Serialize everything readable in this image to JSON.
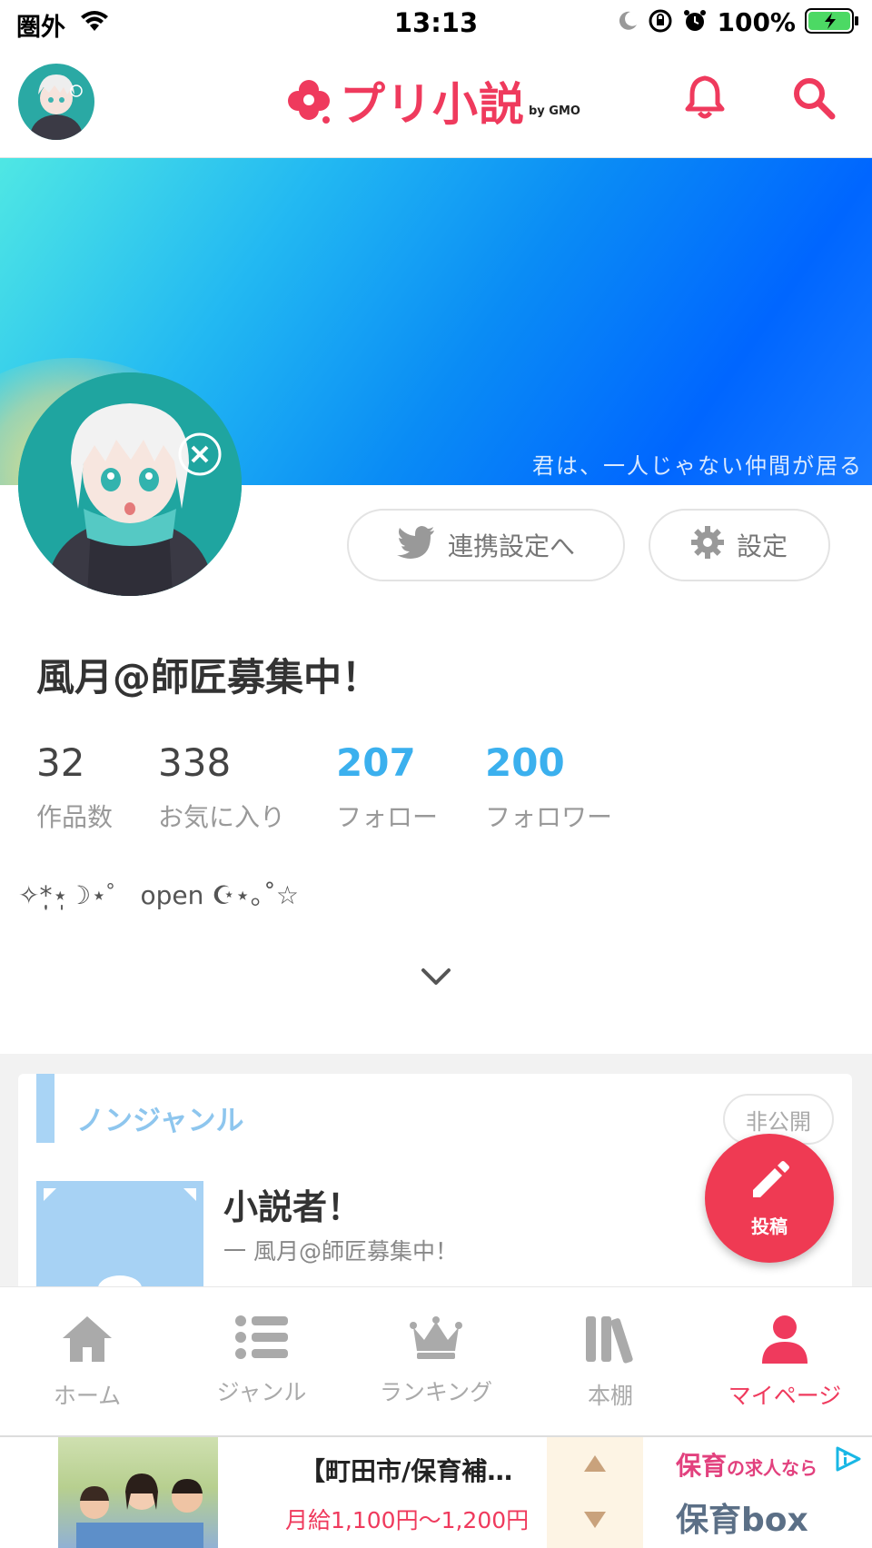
{
  "status_bar": {
    "carrier": "圏外",
    "time": "13:13",
    "battery": "100%"
  },
  "header": {
    "logo_text": "プリ小説",
    "logo_sub": "by GMO"
  },
  "cover": {
    "caption": "君は、一人じゃない仲間が居る"
  },
  "buttons": {
    "link_settings": "連携設定へ",
    "settings": "設定"
  },
  "profile": {
    "name": "風月@師匠募集中！",
    "bio": "✧*̣̩⋆̩☽⋆゜ open ☪⋆｡˚☆"
  },
  "stats": [
    {
      "value": "32",
      "label": "作品数"
    },
    {
      "value": "338",
      "label": "お気に入り"
    },
    {
      "value": "207",
      "label": "フォロー"
    },
    {
      "value": "200",
      "label": "フォロワー"
    }
  ],
  "work": {
    "genre": "ノンジャンル",
    "visibility": "非公開",
    "title": "小説者！",
    "author": "一 風月@師匠募集中！"
  },
  "fab": {
    "label": "投稿"
  },
  "nav": [
    {
      "label": "ホーム",
      "icon": "home-icon",
      "active": false
    },
    {
      "label": "ジャンル",
      "icon": "list-icon",
      "active": false
    },
    {
      "label": "ランキング",
      "icon": "crown-icon",
      "active": false
    },
    {
      "label": "本棚",
      "icon": "bookshelf-icon",
      "active": false
    },
    {
      "label": "マイページ",
      "icon": "person-icon",
      "active": true
    }
  ],
  "ad": {
    "title": "【町田市/保育補…",
    "subtitle": "月給1,100円〜1,200円",
    "brand_line1": "保育",
    "brand_line1_small": "の求人なら",
    "brand_line2": "保育box"
  },
  "colors": {
    "accent": "#ef3a5d",
    "stat_accent": "#3bb0ee",
    "genre": "#8ec6ee"
  }
}
